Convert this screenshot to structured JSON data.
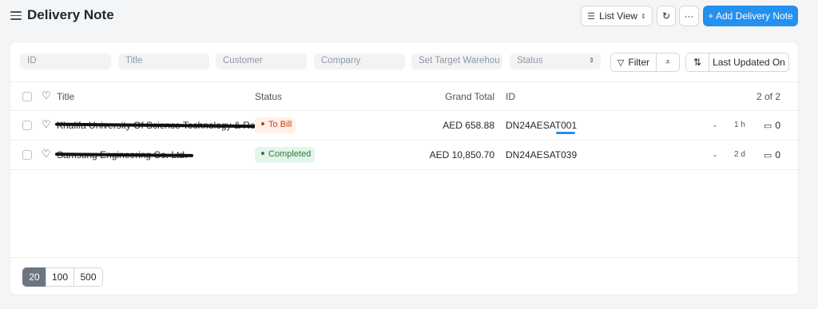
{
  "page": {
    "title": "Delivery Note"
  },
  "toolbar": {
    "list_view_label": "List View",
    "list_view_caret": "⌃",
    "refresh_icon": "↻",
    "more_label": "···",
    "add_label": "+ Add Delivery Note"
  },
  "filters": {
    "id_placeholder": "ID",
    "title_placeholder": "Title",
    "customer_placeholder": "Customer",
    "company_placeholder": "Company",
    "warehouse_placeholder": "Set Target Warehou",
    "status_placeholder": "Status",
    "filter_label": "Filter",
    "sort_label": "Last Updated On"
  },
  "table": {
    "headers": {
      "title": "Title",
      "status": "Status",
      "grand_total": "Grand Total",
      "id": "ID",
      "count": "2 of 2"
    },
    "rows": [
      {
        "title": "Khalifa University Of Science Technology & Rest",
        "status": "To Bill",
        "grand_total": "AED 658.88",
        "id": "DN24AESAT001",
        "dash": "-",
        "modified": "1 h",
        "comments": "0"
      },
      {
        "title": "Samsung Engineering Co. Ltd.",
        "status": "Completed",
        "grand_total": "AED 10,850.70",
        "id": "DN24AESAT039",
        "dash": "-",
        "modified": "2 d",
        "comments": "0"
      }
    ]
  },
  "pagination": {
    "options": [
      "20",
      "100",
      "500"
    ],
    "selected": "20"
  },
  "colors": {
    "primary": "#2490ef",
    "to_bill": "#c0461c",
    "completed": "#2b7a44"
  }
}
